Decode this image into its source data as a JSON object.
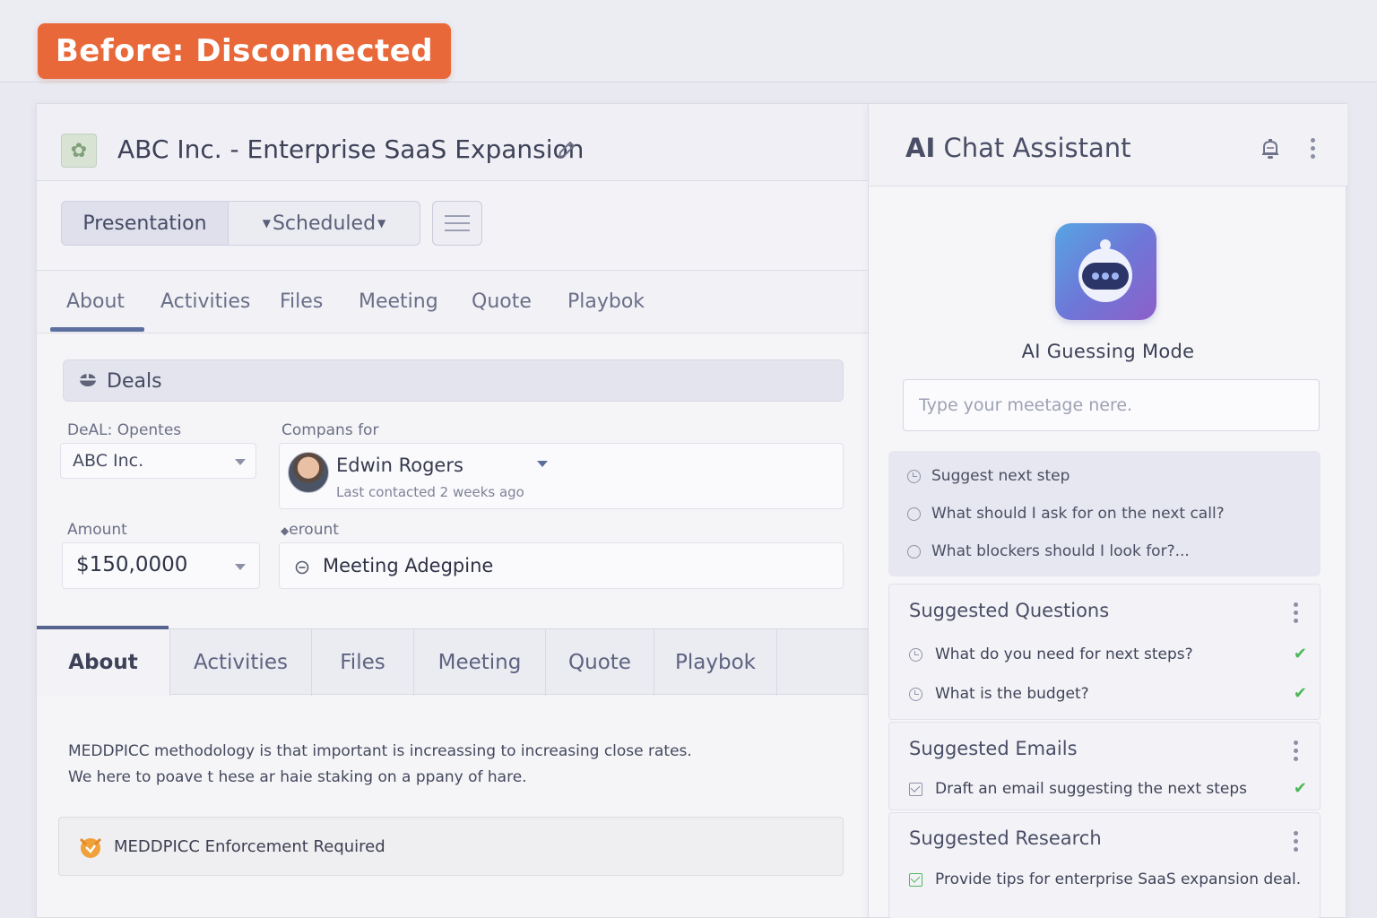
{
  "banner": {
    "label": "Before: Disconnected",
    "color": "#e8683a"
  },
  "deal": {
    "title": "ABC Inc. - Enterprise SaaS Expansion",
    "logo_icon": "company-logo-icon",
    "edit_icon": "pencil-icon",
    "stage": "Presentation",
    "status": "Scheduled"
  },
  "tabs_top": [
    "About",
    "Activities",
    "Files",
    "Meeting",
    "Quote",
    "Playbok"
  ],
  "deals_section": {
    "title": "Deals",
    "fields": {
      "deal_label": "DeAL: Opentes",
      "deal_value": "ABC Inc.",
      "contact_label": "Compans for",
      "contact_name": "Edwin Rogers",
      "contact_sub": "Last contacted 2 weeks ago",
      "amount_label": "Amount",
      "amount_value": "$150,0000",
      "account_label": "erount",
      "account_value": "Meeting Adegpine"
    }
  },
  "tabs_bottom": [
    "About",
    "Activities",
    "Files",
    "Meeting",
    "Quote",
    "Playbok"
  ],
  "description": {
    "line1": "MEDDPICC methodology is that important is increassing to increasing close rates.",
    "line2": "We here to poave t hese ar haie staking on a ppany of hare."
  },
  "enforcement": {
    "label": "MEDDPICC Enforcement Required"
  },
  "chat": {
    "title_bold": "AI",
    "title_rest": " Chat Assistant",
    "mode": "AI Guessing Mode",
    "input_placeholder": "Type your meetage nere.",
    "prompts": [
      "Suggest next step",
      "What should I ask for on the next call?",
      "What blockers should I look for?..."
    ],
    "suggested_questions": {
      "title": "Suggested Questions",
      "items": [
        "What do you need for next steps?",
        "What is the budget?"
      ]
    },
    "suggested_emails": {
      "title": "Suggested Emails",
      "items": [
        "Draft an email suggesting the next steps"
      ]
    },
    "suggested_research": {
      "title": "Suggested Research",
      "items": [
        "Provide tips for enterprise SaaS expansion deal."
      ]
    },
    "check_color": "#4fb85b"
  }
}
